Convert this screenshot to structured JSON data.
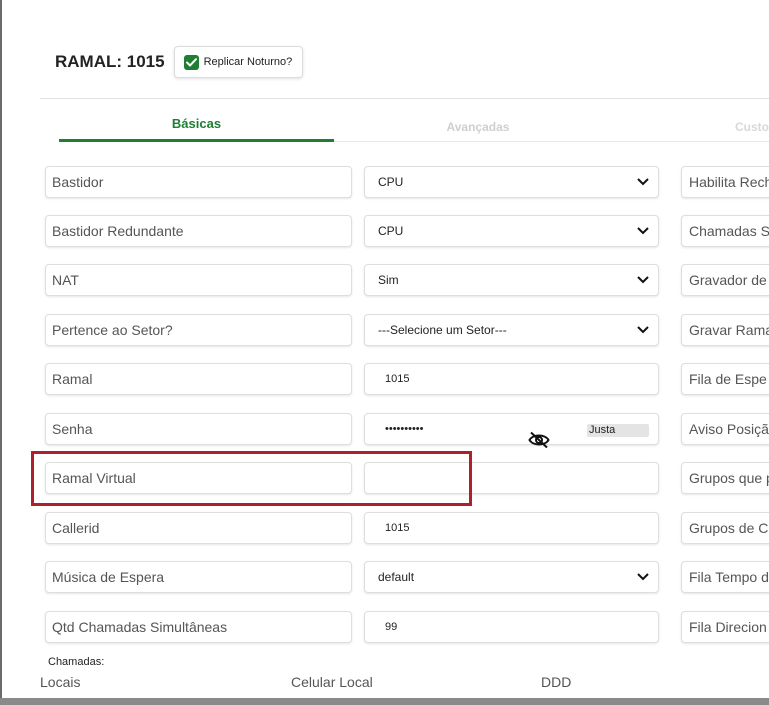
{
  "header": {
    "ramal_title": "RAMAL: 1015",
    "replicar_label": "Replicar Noturno?",
    "replicar_checked": true
  },
  "tabs": [
    {
      "label": "Básicas",
      "active": true
    },
    {
      "label": "Avançadas",
      "active": false
    },
    {
      "label": "Custo",
      "active": false
    }
  ],
  "form": {
    "bastidor": {
      "label": "Bastidor",
      "value": "CPU"
    },
    "bastidor_redundante": {
      "label": "Bastidor Redundante",
      "value": "CPU"
    },
    "nat": {
      "label": "NAT",
      "value": "Sim"
    },
    "setor": {
      "label": "Pertence ao Setor?",
      "value": "---Selecione um Setor---"
    },
    "ramal": {
      "label": "Ramal",
      "value": "1015"
    },
    "senha": {
      "label": "Senha",
      "value": "••••••••••",
      "strength": "Justa"
    },
    "ramal_virtual": {
      "label": "Ramal Virtual",
      "value": ""
    },
    "callerid": {
      "label": "Callerid",
      "value": "1015"
    },
    "musica": {
      "label": "Música de Espera",
      "value": "default"
    },
    "qtd_chamadas": {
      "label": "Qtd Chamadas Simultâneas",
      "value": "99"
    }
  },
  "right_column": [
    "Habilita Rech",
    "Chamadas S",
    "Gravador de",
    "Gravar Rama",
    "Fila de Espe",
    "Aviso Posiçã",
    "Grupos que p",
    "Grupos de C",
    "Fila Tempo d",
    "Fila Direcion"
  ],
  "chamadas": {
    "title": "Chamadas:",
    "columns": [
      "Locais",
      "Celular Local",
      "DDD"
    ]
  },
  "colors": {
    "accent": "#1e7e34",
    "highlight": "#b0202a"
  }
}
